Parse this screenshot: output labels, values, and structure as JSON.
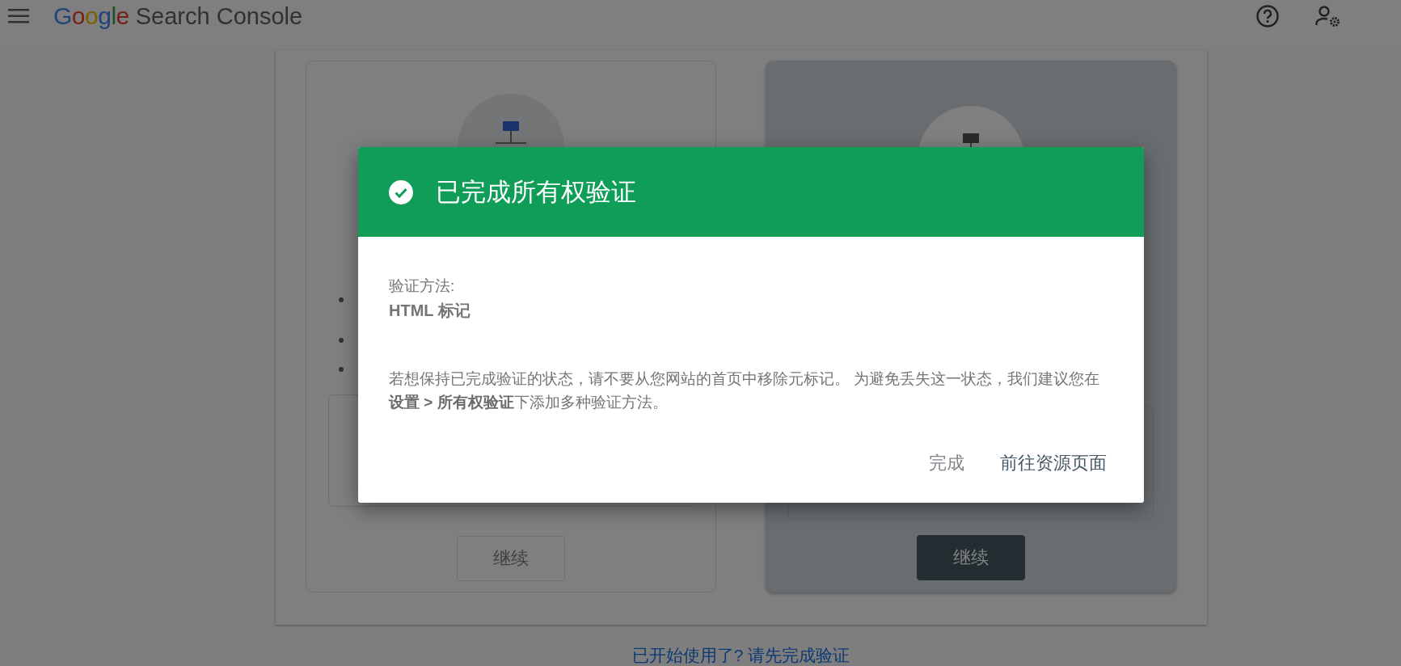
{
  "header": {
    "brand": "Google",
    "product": "Search Console"
  },
  "cards": [
    {
      "selected": false,
      "button": "继续"
    },
    {
      "selected": true,
      "button": "继续"
    }
  ],
  "dialog": {
    "title": "已完成所有权验证",
    "method_label": "验证方法:",
    "method": "HTML 标记",
    "message": "若想保持已完成验证的状态，请不要从您网站的首页中移除元标记。 为避免丢失这一状态，我们建议您在**设置 > 所有权验证**下添加多种验证方法。",
    "actions": [
      {
        "label": "完成",
        "kind": "secondary"
      },
      {
        "label": "前往资源页面",
        "kind": "primary"
      }
    ]
  },
  "footer_link": "已开始使用了? 请先完成验证"
}
